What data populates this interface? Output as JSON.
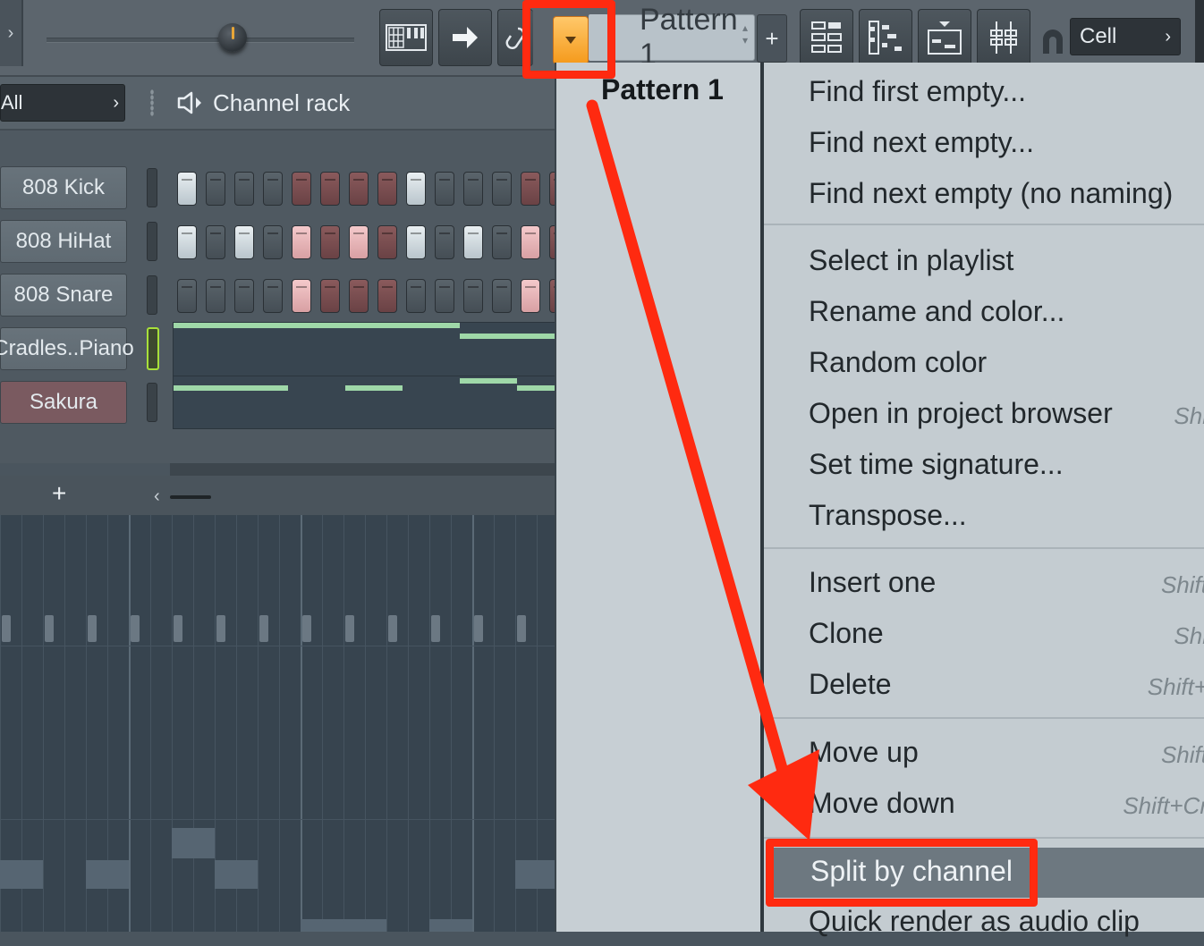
{
  "toolbar": {
    "pattern_label": "Pattern 1",
    "plus_label": "+",
    "snap_label": "Cell",
    "icons": [
      "piano-keyboard-icon",
      "arrow-right-icon",
      "link-icon",
      "dropdown-arrow-icon",
      "playlist-icon",
      "piano-roll-icon",
      "channel-rack-icon",
      "mixer-icon",
      "magnet-icon"
    ]
  },
  "rack": {
    "filter_label": "All",
    "title": "Channel rack",
    "channels": [
      {
        "name": "808 Kick"
      },
      {
        "name": "808 HiHat"
      },
      {
        "name": "808 Snare"
      },
      {
        "name": "Cradles..Piano"
      },
      {
        "name": "Sakura"
      }
    ]
  },
  "playlist": {
    "add_label": "+"
  },
  "menu": {
    "pattern_name": "Pattern 1",
    "items": [
      {
        "label": "Find first empty...",
        "shortcut": ""
      },
      {
        "label": "Find next empty...",
        "shortcut": ""
      },
      {
        "label": "Find next empty (no naming)",
        "shortcut": ""
      },
      {
        "label": "Select in playlist",
        "shortcut": ""
      },
      {
        "label": "Rename and color...",
        "shortcut": ""
      },
      {
        "label": "Random color",
        "shortcut": ""
      },
      {
        "label": "Open in project browser",
        "shortcut": "Shi"
      },
      {
        "label": "Set time signature...",
        "shortcut": ""
      },
      {
        "label": "Transpose...",
        "shortcut": ""
      },
      {
        "label": "Insert one",
        "shortcut": "Shift"
      },
      {
        "label": "Clone",
        "shortcut": "Shi"
      },
      {
        "label": "Delete",
        "shortcut": "Shift+"
      },
      {
        "label": "Move up",
        "shortcut": "Shift"
      },
      {
        "label": "Move down",
        "shortcut": "Shift+Cr"
      },
      {
        "label": "Split by channel",
        "shortcut": ""
      },
      {
        "label": "Quick render as audio clip",
        "shortcut": ""
      }
    ]
  },
  "colors": {
    "annotation_red": "#ff2a10",
    "accent_orange": "#f59a1c",
    "note_green": "#9fd8a8",
    "menu_bg": "#c4ccd1",
    "menu_highlight": "#6d7880"
  }
}
